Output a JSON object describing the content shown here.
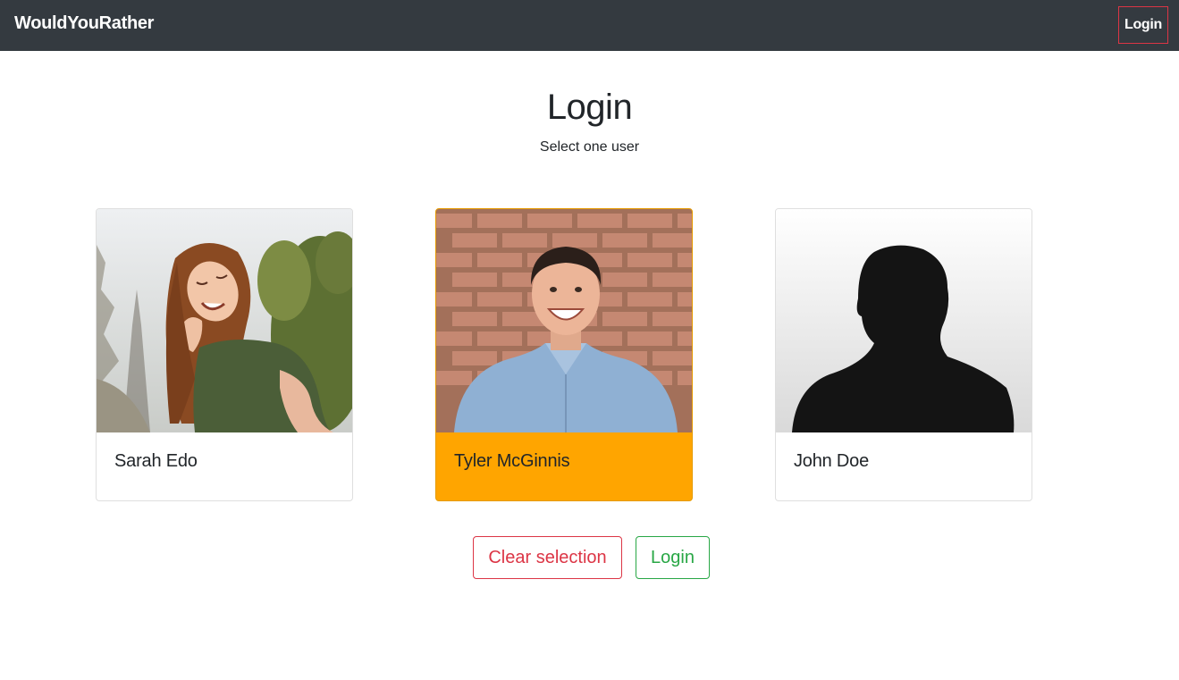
{
  "navbar": {
    "brand": "WouldYouRather",
    "login_link": "Login"
  },
  "page": {
    "title": "Login",
    "subtitle": "Select one user"
  },
  "users": [
    {
      "name": "Sarah Edo",
      "selected": false
    },
    {
      "name": "Tyler McGinnis",
      "selected": true
    },
    {
      "name": "John Doe",
      "selected": false
    }
  ],
  "actions": {
    "clear_label": "Clear selection",
    "login_label": "Login"
  },
  "colors": {
    "navbar_bg": "#343a40",
    "selected_card": "#ffa500",
    "danger": "#dc3545",
    "success": "#28a745"
  }
}
